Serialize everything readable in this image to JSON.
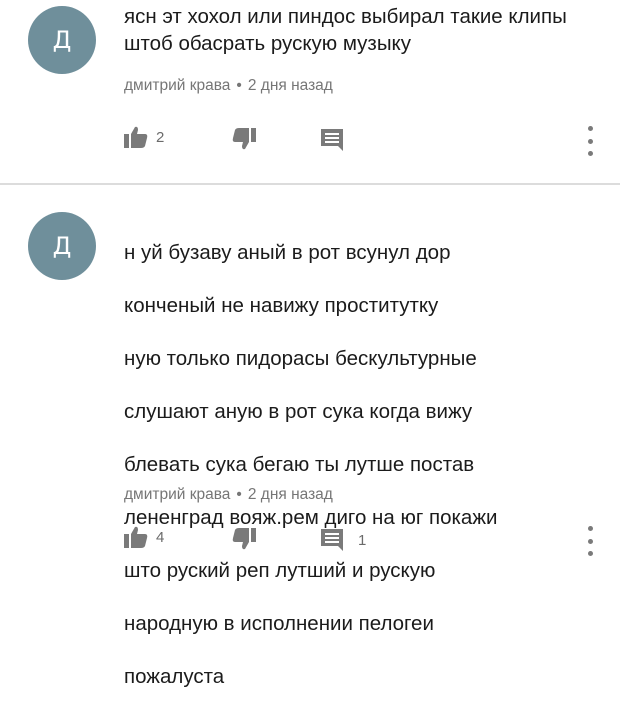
{
  "comments": [
    {
      "avatar_letter": "Д",
      "text": "ясн эт хохол или пиндос выбирал такие клипы штоб обасрать рускую музыку",
      "author": "дмитрий крава",
      "separator": "•",
      "time": "2 дня назад",
      "likes": "2",
      "replies": ""
    },
    {
      "avatar_letter": "Д",
      "text_lines": [
        "н уй бузаву   аный в рот всунул   дор",
        "конченый не навижу проститутку",
        "  ную только пидорасы бескультурные",
        "слушают   аную в рот сука когда вижу",
        "блевать сука бегаю ты лутше постав",
        "лененград вояж.рем диго на юг покажи",
        "што руский реп лутший и рускую",
        "народную в исполнении пелогеи",
        "пожалуста"
      ],
      "author": "дмитрий крава",
      "separator": "•",
      "time": "2 дня назад",
      "likes": "4",
      "replies": "1"
    }
  ],
  "icons": {
    "like": "thumbs-up-icon",
    "dislike": "thumbs-down-icon",
    "reply": "comment-reply-icon",
    "more": "more-vertical-icon"
  },
  "colors": {
    "avatar": "#6f8f9b",
    "icon": "#7a7a7a",
    "meta_text": "#767676",
    "divider": "#dcdcdc"
  }
}
